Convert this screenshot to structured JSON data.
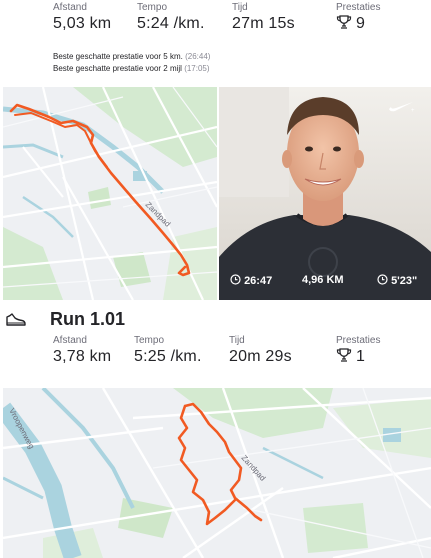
{
  "run1": {
    "stats": [
      {
        "label": "Afstand",
        "value": "5,03 km"
      },
      {
        "label": "Tempo",
        "value": "5:24 /km."
      },
      {
        "label": "Tijd",
        "value": "27m 15s"
      },
      {
        "label": "Prestaties",
        "value": "9"
      }
    ],
    "best": [
      {
        "text": "Beste geschatte prestatie voor 5 km.",
        "time": "(26:44)"
      },
      {
        "text": "Beste geschatte prestatie voor 2 mijl",
        "time": "(17:05)"
      }
    ],
    "map_street": "Zandpad",
    "photo_overlay": {
      "time": "26:47",
      "distance": "4,96 KM",
      "pace": "5'23\""
    }
  },
  "run2": {
    "title": "Run 1.01",
    "stats": [
      {
        "label": "Afstand",
        "value": "3,78 km"
      },
      {
        "label": "Tempo",
        "value": "5:25 /km."
      },
      {
        "label": "Tijd",
        "value": "20m 29s"
      },
      {
        "label": "Prestaties",
        "value": "1"
      }
    ],
    "map_street": "Zandpad",
    "map_road": "Vroopenweg"
  },
  "colors": {
    "route": "#f15a22",
    "water": "#aad3df",
    "park": "#c9e6c2",
    "map_bg": "#eef0f3"
  },
  "icons": [
    "trophy-icon",
    "shoe-icon",
    "clock-icon",
    "nike-swoosh-icon"
  ]
}
